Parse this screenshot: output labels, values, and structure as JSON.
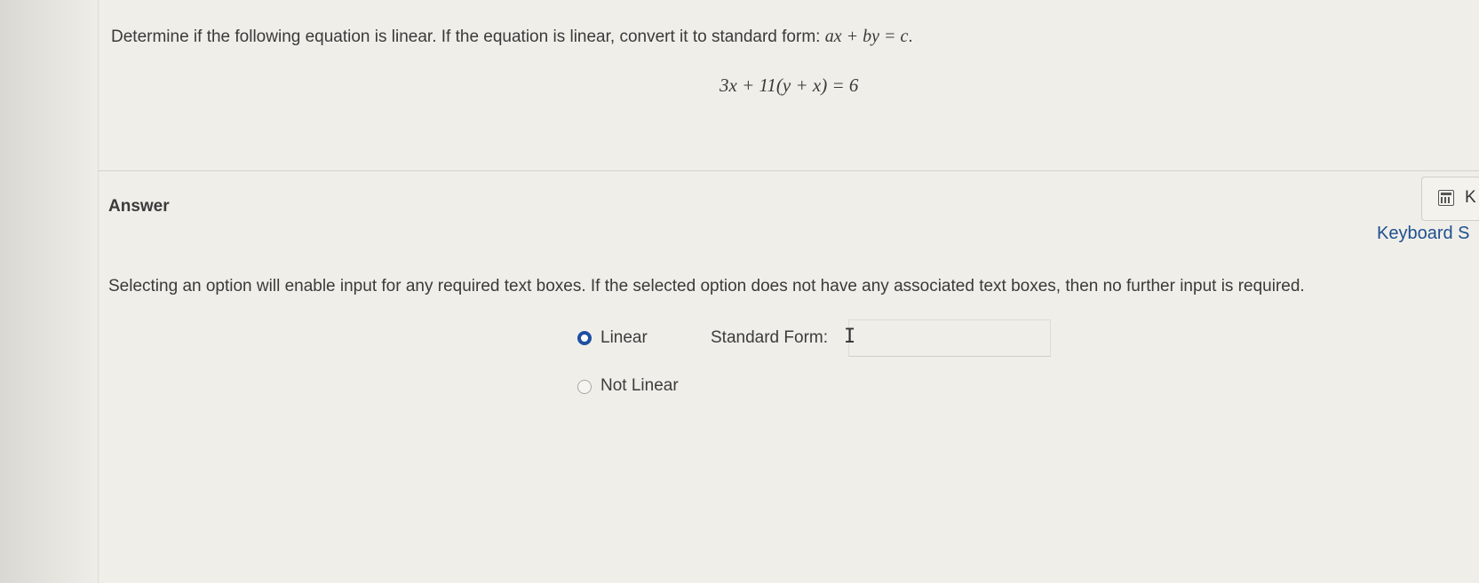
{
  "question": {
    "prompt": "Determine if the following equation is linear. If the equation is linear, convert it to standard form: ",
    "standard_form_math": "ax + by = c",
    "prompt_end": ".",
    "equation": "3x + 11(y + x) = 6"
  },
  "answer": {
    "heading": "Answer",
    "calculator_label": "K",
    "keyboard_link": "Keyboard S",
    "instructions": "Selecting an option will enable input for any required text boxes. If the selected option does not have any associated text boxes, then no further input is required.",
    "options": [
      {
        "label": "Linear",
        "selected": true
      },
      {
        "label": "Not Linear",
        "selected": false
      }
    ],
    "standard_form_label": "Standard Form:",
    "standard_form_value": ""
  },
  "colors": {
    "accent": "#1e4fa3",
    "link": "#1f4f8f",
    "background": "#efeee9"
  },
  "icons": [
    "calculator-icon",
    "text-cursor-icon"
  ]
}
